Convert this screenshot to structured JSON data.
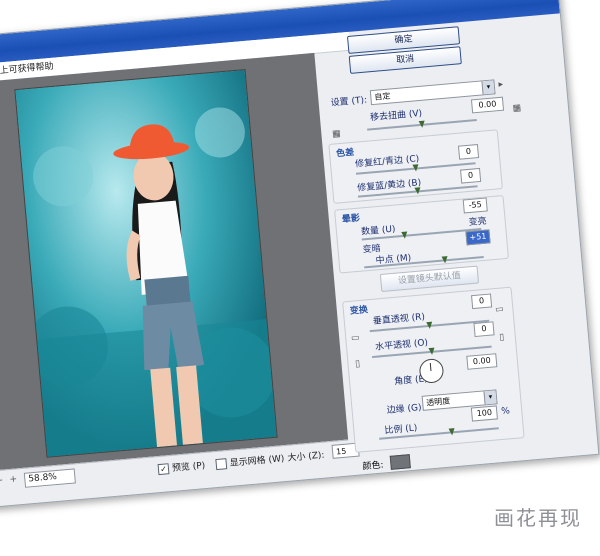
{
  "help_text": "件上可获得帮助",
  "buttons": {
    "ok": "确定",
    "cancel": "取消"
  },
  "settings": {
    "label": "设置 (T):",
    "value": "自定"
  },
  "geometric": {
    "label": "移去扭曲 (V)",
    "value": "0.00"
  },
  "chromatic": {
    "title": "色差",
    "red_cyan": {
      "label": "修复红/青边 (C)",
      "value": "0"
    },
    "blue_yellow": {
      "label": "修复蓝/黄边 (B)",
      "value": "0"
    }
  },
  "vignette": {
    "title": "晕影",
    "amount": {
      "label": "数量 (U)",
      "value": "-55",
      "left": "变暗",
      "right": "变亮"
    },
    "midpoint": {
      "label": "中点 (M)",
      "value": "+51"
    }
  },
  "set_default": "设置镜头默认值",
  "transform": {
    "title": "变换",
    "vertical": {
      "label": "垂直透视 (R)",
      "value": "0"
    },
    "horizontal": {
      "label": "水平透视 (O)",
      "value": "0"
    },
    "angle": {
      "label": "角度 (E):",
      "value": "0.00"
    },
    "edge": {
      "label": "边缘 (G):",
      "value": "透明度"
    },
    "scale": {
      "label": "比例 (L)",
      "value": "100",
      "unit": "%"
    }
  },
  "statusbar": {
    "zoom": "58.8%",
    "preview": {
      "label": "预览 (P)",
      "checked": true
    },
    "grid": {
      "label": "显示网格 (W)",
      "checked": false
    },
    "size": {
      "label": "大小 (Z):",
      "value": "15"
    },
    "color": {
      "label": "颜色:"
    }
  },
  "watermark": "画花再现",
  "colors": {
    "titlebar": "#1a4fb3",
    "sky": "#2c9aa8",
    "hat": "#f05a33",
    "section": "#2b55a5"
  }
}
